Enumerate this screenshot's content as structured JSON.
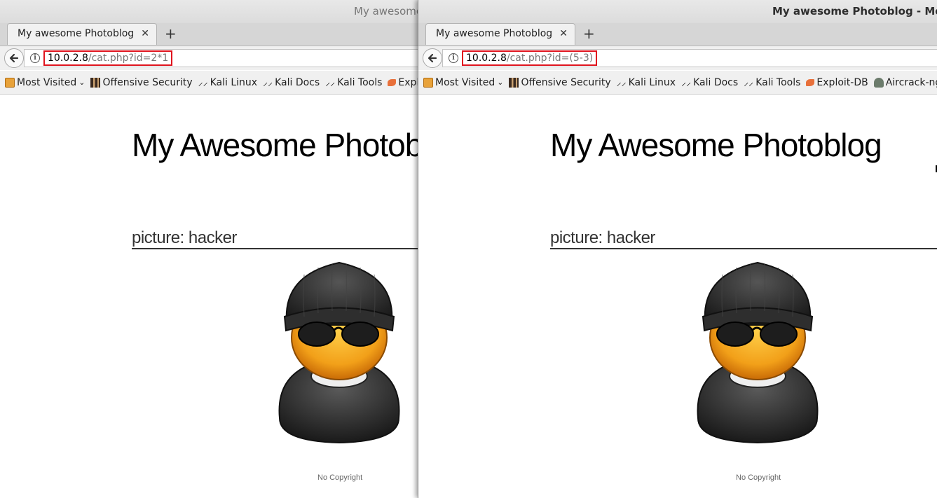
{
  "windows": [
    {
      "title": "My awesome",
      "tab_label": "My awesome Photoblog",
      "url_host": "10.0.2.8",
      "url_path": "/cat.php?id=2*1",
      "bookmarks": [
        "Most Visited",
        "Offensive Security",
        "Kali Linux",
        "Kali Docs",
        "Kali Tools",
        "Exploit-"
      ],
      "site_title": "My Awesome Photob",
      "picture_heading": "picture: hacker",
      "footer": "No Copyright"
    },
    {
      "title": "My awesome Photoblog - Mozilla Fi",
      "tab_label": "My awesome Photoblog",
      "url_host": "10.0.2.8",
      "url_path": "/cat.php?id=(5-3)",
      "bookmarks": [
        "Most Visited",
        "Offensive Security",
        "Kali Linux",
        "Kali Docs",
        "Kali Tools",
        "Exploit-DB",
        "Aircrack-ng"
      ],
      "site_title": "My Awesome Photoblog",
      "picture_heading": "picture: hacker",
      "footer": "No Copyright"
    }
  ],
  "icons": {
    "back": "back-arrow-icon",
    "info": "info-icon",
    "close_tab": "close-icon",
    "new_tab": "plus-icon"
  },
  "colors": {
    "url_highlight": "#e0141e"
  }
}
